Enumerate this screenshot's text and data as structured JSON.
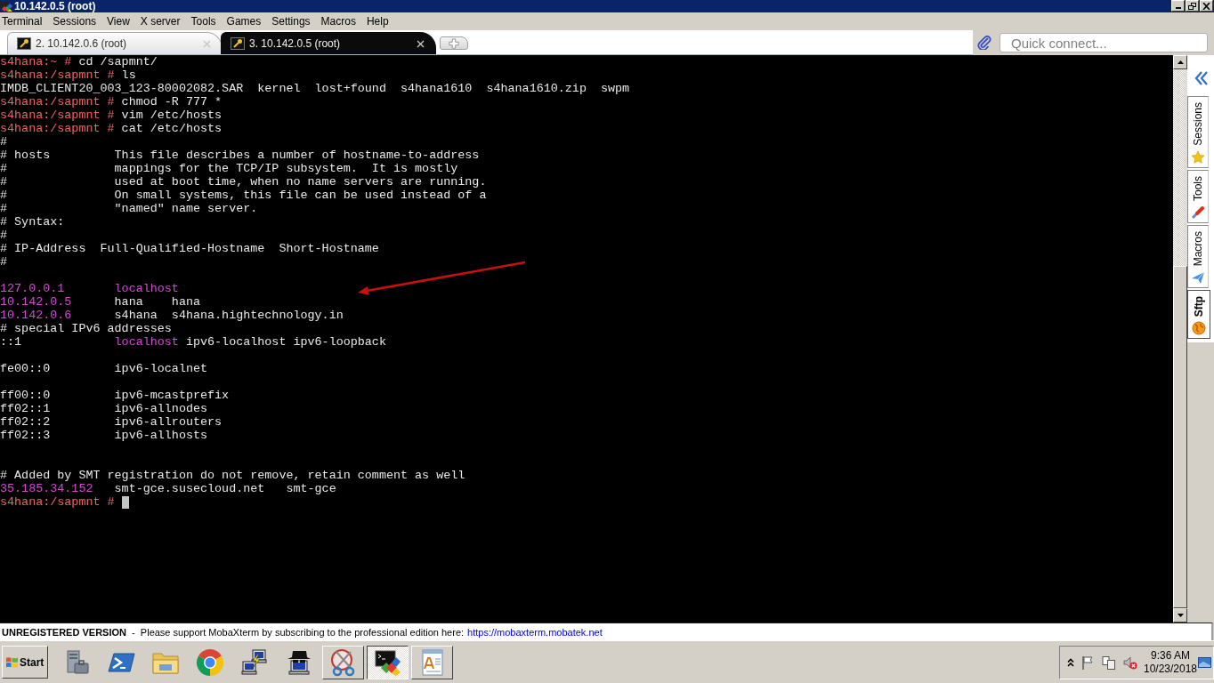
{
  "window": {
    "title": "10.142.0.5 (root)"
  },
  "menu": [
    "Terminal",
    "Sessions",
    "View",
    "X server",
    "Tools",
    "Games",
    "Settings",
    "Macros",
    "Help"
  ],
  "tabs": [
    {
      "label": "2. 10.142.0.6 (root)",
      "selected": false
    },
    {
      "label": "3. 10.142.0.5 (root)",
      "selected": true
    }
  ],
  "quick_connect": {
    "placeholder": "Quick connect..."
  },
  "terminal": {
    "lines": [
      {
        "kind": "text",
        "segments": [
          {
            "kind": "prompt",
            "text": "s4hana:~ #"
          },
          {
            "kind": "plain",
            "text": " cd /sapmnt/"
          }
        ]
      },
      {
        "kind": "text",
        "segments": [
          {
            "kind": "prompt",
            "text": "s4hana:/sapmnt #"
          },
          {
            "kind": "plain",
            "text": " ls"
          }
        ]
      },
      {
        "kind": "text",
        "segments": [
          {
            "kind": "plain",
            "text": "IMDB_CLIENT20_003_123-80002082.SAR  kernel  lost+found  s4hana1610  s4hana1610.zip  swpm"
          }
        ]
      },
      {
        "kind": "text",
        "segments": [
          {
            "kind": "prompt",
            "text": "s4hana:/sapmnt #"
          },
          {
            "kind": "plain",
            "text": " chmod -R 777 *"
          }
        ]
      },
      {
        "kind": "text",
        "segments": [
          {
            "kind": "prompt",
            "text": "s4hana:/sapmnt #"
          },
          {
            "kind": "plain",
            "text": " vim /etc/hosts"
          }
        ]
      },
      {
        "kind": "text",
        "segments": [
          {
            "kind": "prompt",
            "text": "s4hana:/sapmnt #"
          },
          {
            "kind": "plain",
            "text": " cat /etc/hosts"
          }
        ]
      },
      {
        "kind": "text",
        "segments": [
          {
            "kind": "plain",
            "text": "#"
          }
        ]
      },
      {
        "kind": "text",
        "segments": [
          {
            "kind": "plain",
            "text": "# hosts         This file describes a number of hostname-to-address"
          }
        ]
      },
      {
        "kind": "text",
        "segments": [
          {
            "kind": "plain",
            "text": "#               mappings for the TCP/IP subsystem.  It is mostly"
          }
        ]
      },
      {
        "kind": "text",
        "segments": [
          {
            "kind": "plain",
            "text": "#               used at boot time, when no name servers are running."
          }
        ]
      },
      {
        "kind": "text",
        "segments": [
          {
            "kind": "plain",
            "text": "#               On small systems, this file can be used instead of a"
          }
        ]
      },
      {
        "kind": "text",
        "segments": [
          {
            "kind": "plain",
            "text": "#               \"named\" name server."
          }
        ]
      },
      {
        "kind": "text",
        "segments": [
          {
            "kind": "plain",
            "text": "# Syntax:"
          }
        ]
      },
      {
        "kind": "text",
        "segments": [
          {
            "kind": "plain",
            "text": "#"
          }
        ]
      },
      {
        "kind": "text",
        "segments": [
          {
            "kind": "plain",
            "text": "# IP-Address  Full-Qualified-Hostname  Short-Hostname"
          }
        ]
      },
      {
        "kind": "text",
        "segments": [
          {
            "kind": "plain",
            "text": "#"
          }
        ]
      },
      {
        "kind": "blank"
      },
      {
        "kind": "text",
        "segments": [
          {
            "kind": "highlight",
            "text": "127.0.0.1       localhost"
          }
        ]
      },
      {
        "kind": "text",
        "segments": [
          {
            "kind": "highlight",
            "text": "10.142.0.5"
          },
          {
            "kind": "plain",
            "text": "      hana    hana"
          }
        ]
      },
      {
        "kind": "text",
        "segments": [
          {
            "kind": "highlight",
            "text": "10.142.0.6"
          },
          {
            "kind": "plain",
            "text": "      s4hana  s4hana.hightechnology.in"
          }
        ]
      },
      {
        "kind": "text",
        "segments": [
          {
            "kind": "plain",
            "text": "# special IPv6 addresses"
          }
        ]
      },
      {
        "kind": "text",
        "segments": [
          {
            "kind": "plain",
            "text": "::1             "
          },
          {
            "kind": "highlight",
            "text": "localhost"
          },
          {
            "kind": "plain",
            "text": " ipv6-localhost ipv6-loopback"
          }
        ]
      },
      {
        "kind": "blank"
      },
      {
        "kind": "text",
        "segments": [
          {
            "kind": "plain",
            "text": "fe00::0         ipv6-localnet"
          }
        ]
      },
      {
        "kind": "blank"
      },
      {
        "kind": "text",
        "segments": [
          {
            "kind": "plain",
            "text": "ff00::0         ipv6-mcastprefix"
          }
        ]
      },
      {
        "kind": "text",
        "segments": [
          {
            "kind": "plain",
            "text": "ff02::1         ipv6-allnodes"
          }
        ]
      },
      {
        "kind": "text",
        "segments": [
          {
            "kind": "plain",
            "text": "ff02::2         ipv6-allrouters"
          }
        ]
      },
      {
        "kind": "text",
        "segments": [
          {
            "kind": "plain",
            "text": "ff02::3         ipv6-allhosts"
          }
        ]
      },
      {
        "kind": "blank"
      },
      {
        "kind": "blank"
      },
      {
        "kind": "text",
        "segments": [
          {
            "kind": "plain",
            "text": "# Added by SMT registration do not remove, retain comment as well"
          }
        ]
      },
      {
        "kind": "text",
        "segments": [
          {
            "kind": "highlight",
            "text": "35.185.34.152"
          },
          {
            "kind": "plain",
            "text": "   smt-gce.susecloud.net   smt-gce"
          }
        ]
      },
      {
        "kind": "text",
        "segments": [
          {
            "kind": "prompt",
            "text": "s4hana:/sapmnt #"
          },
          {
            "kind": "cursor"
          }
        ]
      }
    ]
  },
  "side_tabs": [
    {
      "label": "Sessions",
      "selected": false
    },
    {
      "label": "Tools",
      "selected": false
    },
    {
      "label": "Macros",
      "selected": false
    },
    {
      "label": "Sftp",
      "selected": true
    }
  ],
  "status_bar": {
    "message": "**UNREGISTERED VERSION**  -  Please support MobaXterm by subscribing to the professional edition here:",
    "link": "https://mobaxterm.mobatek.net"
  },
  "taskbar": {
    "start": "Start",
    "apps": [
      {
        "open": false,
        "selected": false
      },
      {
        "open": false,
        "selected": false
      },
      {
        "open": false,
        "selected": false
      },
      {
        "open": false,
        "selected": false
      },
      {
        "open": false,
        "selected": false
      },
      {
        "open": false,
        "selected": false
      },
      {
        "open": true,
        "selected": false
      },
      {
        "open": true,
        "selected": true
      },
      {
        "open": true,
        "selected": false
      }
    ],
    "tray": {
      "time": "9:36 AM",
      "date": "10/23/2018"
    }
  }
}
